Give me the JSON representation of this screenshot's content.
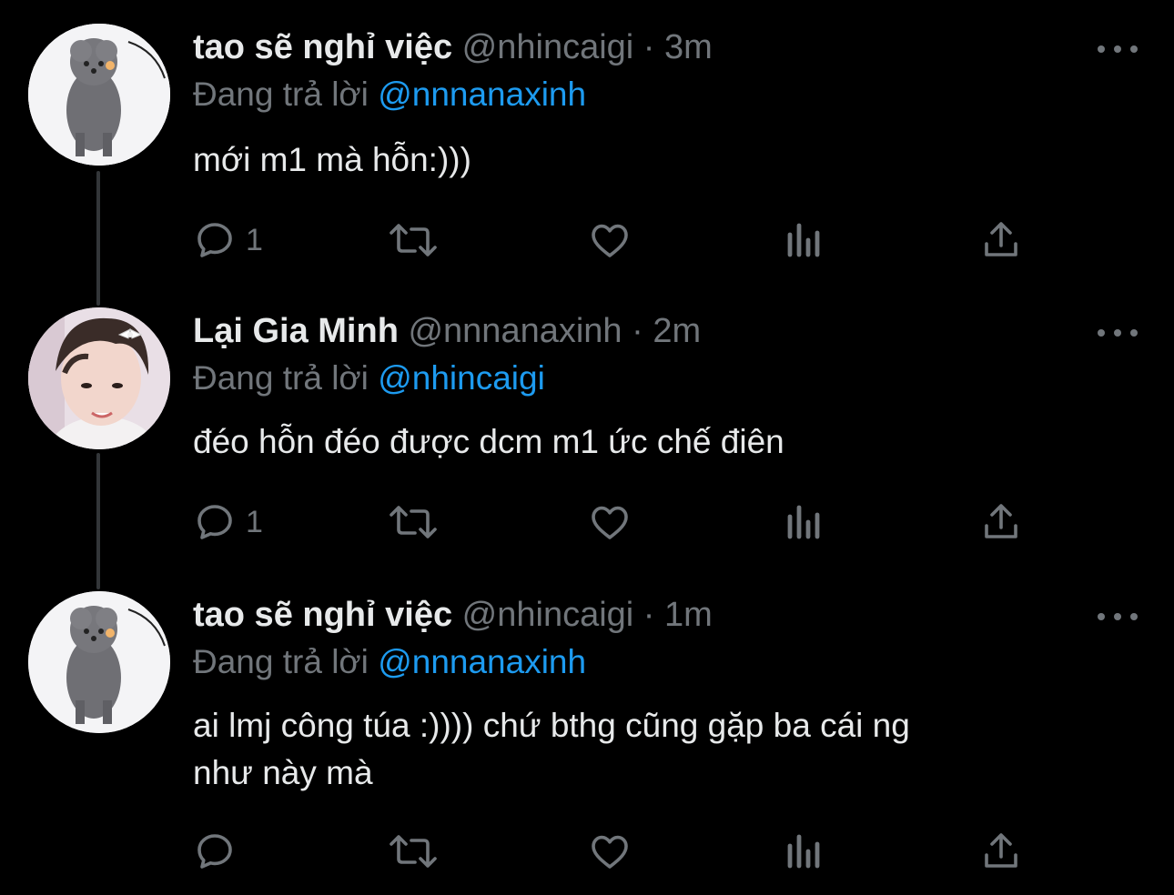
{
  "tweets": [
    {
      "name": "tao sẽ nghỉ việc",
      "handle": "@nhincaigi",
      "separator": "·",
      "time": "3m",
      "reply_prefix": "Đang trả lời",
      "reply_to": "@nnnanaxinh",
      "text": "mới m1 mà hỗn:)))",
      "reply_count": "1"
    },
    {
      "name": "Lại Gia Minh",
      "handle": "@nnnanaxinh",
      "separator": "·",
      "time": "2m",
      "reply_prefix": "Đang trả lời",
      "reply_to": "@nhincaigi",
      "text": "đéo hỗn đéo được dcm m1 ức chế điên",
      "reply_count": "1"
    },
    {
      "name": "tao sẽ nghỉ việc",
      "handle": "@nhincaigi",
      "separator": "·",
      "time": "1m",
      "reply_prefix": "Đang trả lời",
      "reply_to": "@nnnanaxinh",
      "text_line1": "ai lmj công túa :)))) chứ bthg cũng gặp ba cái ng",
      "text_line2": "như này mà",
      "reply_count": ""
    }
  ],
  "icons": {
    "reply": "reply-icon",
    "retweet": "retweet-icon",
    "like": "heart-icon",
    "views": "views-icon",
    "share": "share-icon",
    "more": "more-icon"
  },
  "colors": {
    "background": "#000000",
    "primary_text": "#e7e9ea",
    "secondary_text": "#71767b",
    "link": "#1d9bf0",
    "thread_line": "#333639"
  }
}
